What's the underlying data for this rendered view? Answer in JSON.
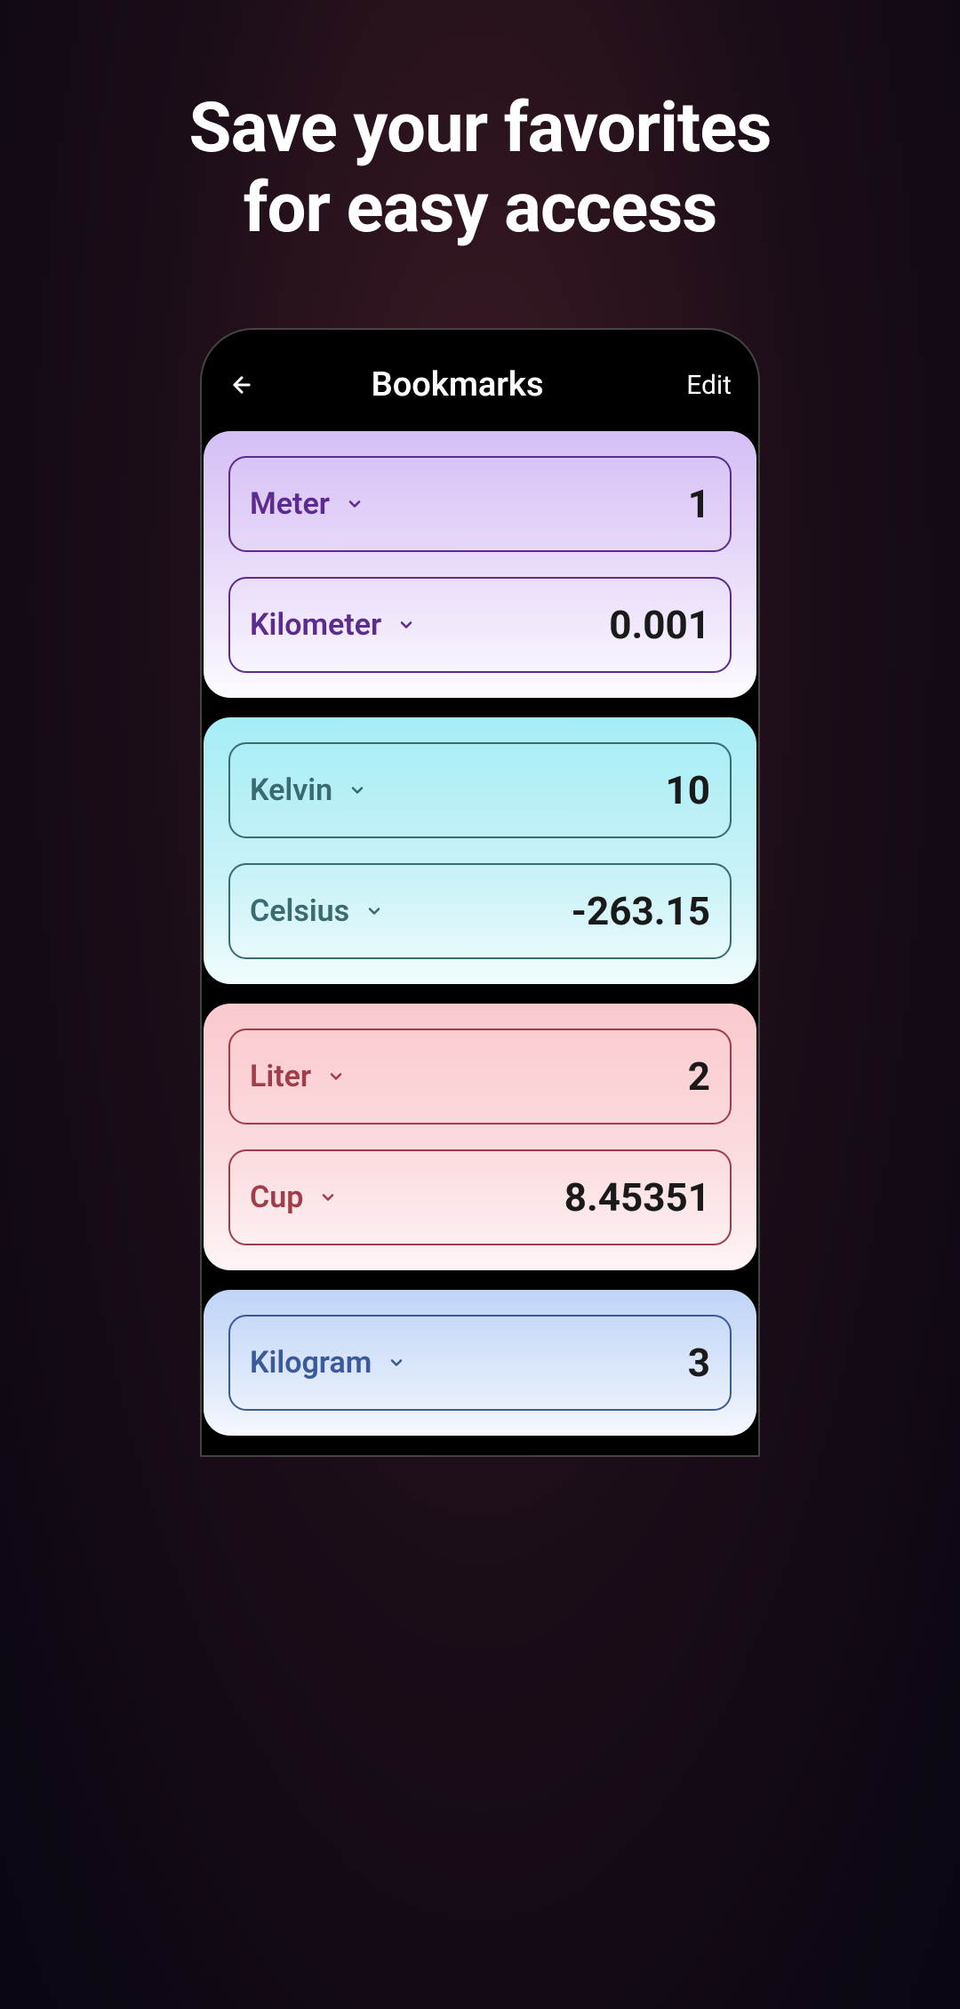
{
  "promo": {
    "line1": "Save your favorites",
    "line2": "for easy access"
  },
  "header": {
    "title": "Bookmarks",
    "edit": "Edit"
  },
  "cards": [
    {
      "theme": "purple",
      "from": {
        "unit": "Meter",
        "value": "1"
      },
      "to": {
        "unit": "Kilometer",
        "value": "0.001"
      }
    },
    {
      "theme": "cyan",
      "from": {
        "unit": "Kelvin",
        "value": "10"
      },
      "to": {
        "unit": "Celsius",
        "value": "-263.15"
      }
    },
    {
      "theme": "pink",
      "from": {
        "unit": "Liter",
        "value": "2"
      },
      "to": {
        "unit": "Cup",
        "value": "8.45351"
      }
    },
    {
      "theme": "blue",
      "from": {
        "unit": "Kilogram",
        "value": "3"
      },
      "to": {
        "unit": "",
        "value": ""
      }
    }
  ]
}
